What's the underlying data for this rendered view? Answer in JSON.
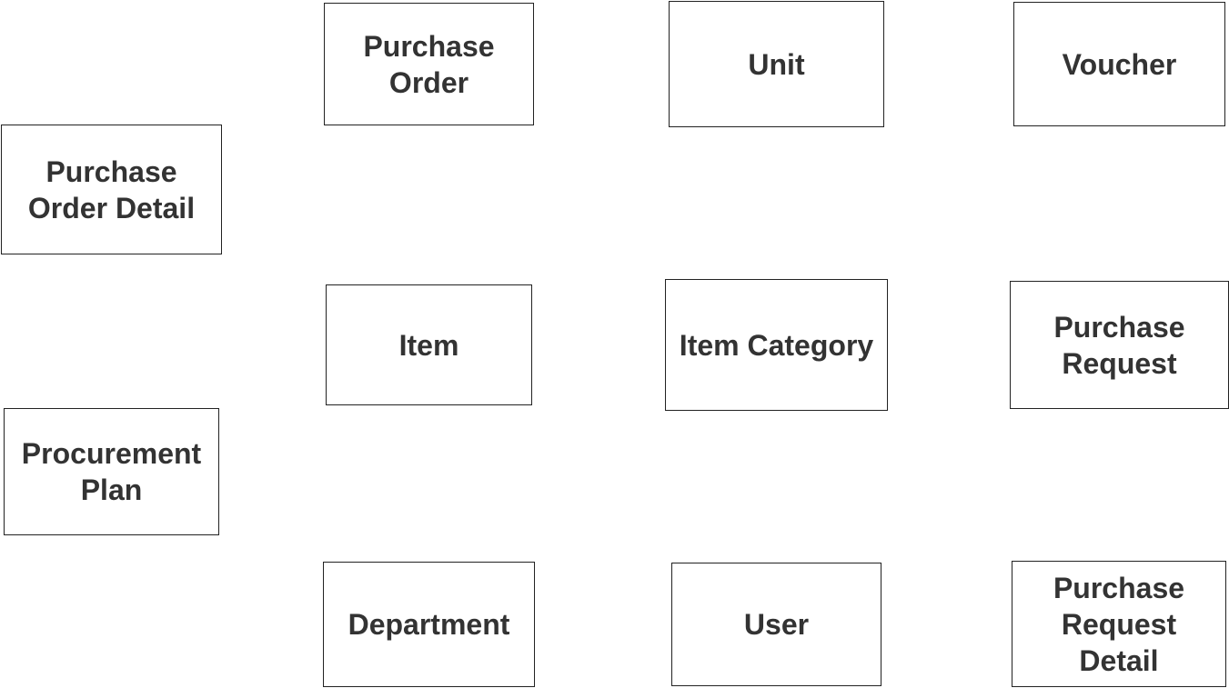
{
  "diagram": {
    "type": "entity-list",
    "entities": [
      {
        "id": "purchase-order",
        "label": "Purchase\nOrder"
      },
      {
        "id": "unit",
        "label": "Unit"
      },
      {
        "id": "voucher",
        "label": "Voucher"
      },
      {
        "id": "purchase-order-detail",
        "label": "Purchase\nOrder Detail"
      },
      {
        "id": "item",
        "label": "Item"
      },
      {
        "id": "item-category",
        "label": "Item Category"
      },
      {
        "id": "purchase-request",
        "label": "Purchase\nRequest"
      },
      {
        "id": "procurement-plan",
        "label": "Procurement\nPlan"
      },
      {
        "id": "department",
        "label": "Department"
      },
      {
        "id": "user",
        "label": "User"
      },
      {
        "id": "purchase-request-detail",
        "label": "Purchase\nRequest\nDetail"
      }
    ]
  }
}
